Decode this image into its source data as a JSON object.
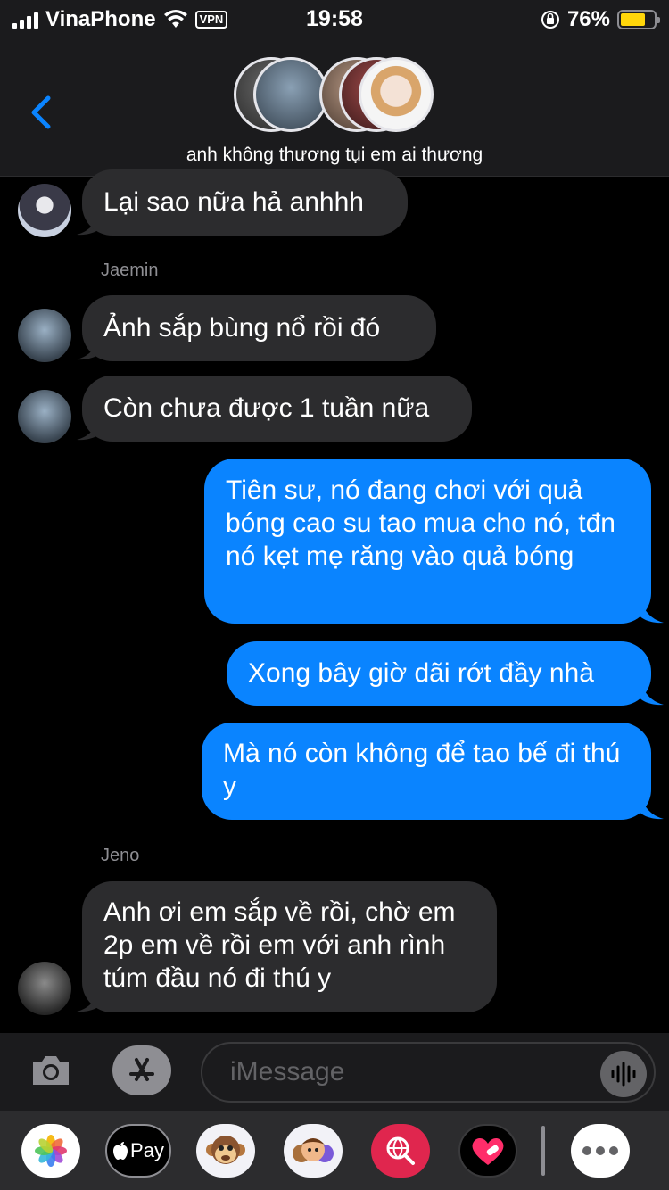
{
  "status_bar": {
    "carrier": "VinaPhone",
    "vpn": "VPN",
    "time": "19:58",
    "battery": "76%",
    "battery_level": 0.76
  },
  "header": {
    "group_name": "anh không thương tụi em ai thương"
  },
  "messages": [
    {
      "text": "Lại sao nữa hả anhhh"
    },
    {
      "sender": "Jaemin"
    },
    {
      "text": "Ảnh sắp bùng nổ rồi đó"
    },
    {
      "text": "Còn chưa được 1 tuần nữa"
    },
    {
      "text": "Tiên sư, nó đang chơi với quả bóng cao su tao mua cho nó, tđn nó kẹt mẹ răng vào quả bóng"
    },
    {
      "text": "Xong bây giờ dãi rớt đầy nhà"
    },
    {
      "text": "Mà nó còn không để tao bế đi thú y"
    },
    {
      "sender": "Jeno"
    },
    {
      "text": "Anh ơi em sắp về rồi, chờ em 2p em về rồi em với anh rình túm đầu nó đi thú y"
    }
  ],
  "compose": {
    "placeholder": "iMessage"
  },
  "drawer": {
    "apple_pay": "Pay"
  },
  "colors": {
    "outgoing": "#0a84ff",
    "incoming": "#2c2c2e",
    "background": "#000000"
  }
}
